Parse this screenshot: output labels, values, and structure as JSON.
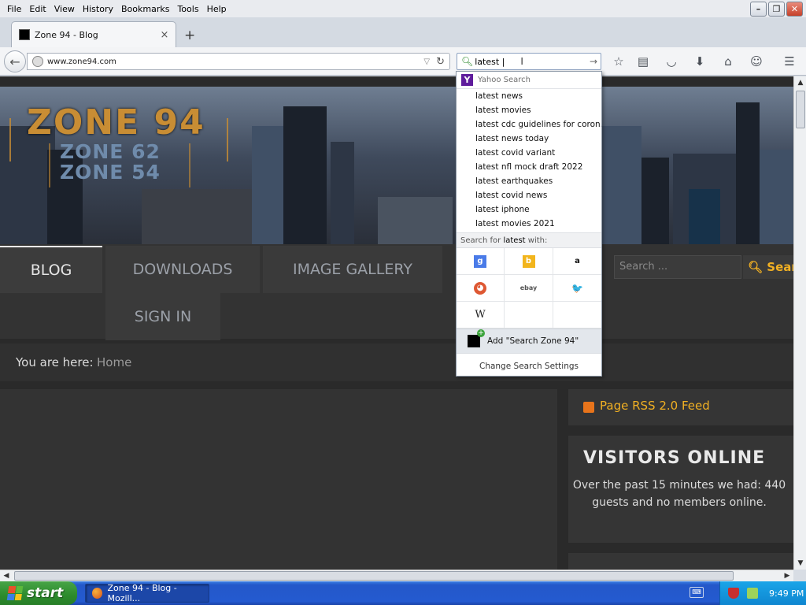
{
  "menu": {
    "items": [
      "File",
      "Edit",
      "View",
      "History",
      "Bookmarks",
      "Tools",
      "Help"
    ]
  },
  "window_controls": {
    "minimize": "–",
    "restore": "❐",
    "close": "✕"
  },
  "tab": {
    "title": "Zone 94 - Blog",
    "close": "×"
  },
  "new_tab": "+",
  "urlbar": {
    "url": "www.zone94.com"
  },
  "searchbox": {
    "value": "latest |"
  },
  "suggestions": {
    "engine_name": "Yahoo Search",
    "items": [
      "latest news",
      "latest movies",
      "latest cdc guidelines for coron...",
      "latest news today",
      "latest covid variant",
      "latest nfl mock draft 2022",
      "latest earthquakes",
      "latest covid news",
      "latest iphone",
      "latest movies 2021"
    ],
    "search_for_prefix": "Search for",
    "search_for_term": "latest",
    "search_for_suffix": "with:",
    "engines": [
      "google",
      "bing",
      "amazon",
      "duckduckgo",
      "ebay",
      "twitter",
      "wikipedia"
    ],
    "engine_glyphs": {
      "google": "g",
      "bing": "b",
      "amazon": "a",
      "duckduckgo": "◕",
      "ebay": "ebay",
      "twitter": "🐦",
      "wikipedia": "W"
    },
    "add_search": "Add \"Search Zone 94\"",
    "change_settings": "Change Search Settings"
  },
  "site": {
    "logo_main": "ZONE 94",
    "logo_sub1": "ZONE 62",
    "logo_sub2": "ZONE 54",
    "nav": [
      "BLOG",
      "DOWNLOADS",
      "IMAGE GALLERY",
      "SIGN IN"
    ],
    "search_placeholder": "Search ...",
    "search_button": "Search",
    "breadcrumb_label": "You are here:",
    "breadcrumb_home": "Home",
    "rss": "Page RSS 2.0 Feed",
    "visitors_title": "VISITORS ONLINE",
    "visitors_body": "Over the past 15 minutes we had: 440 guests and no members online."
  },
  "taskbar": {
    "start": "start",
    "item": "Zone 94 - Blog - Mozill...",
    "clock": "9:49 PM"
  },
  "colors": {
    "accent_orange": "#f1b023",
    "logo_gold": "#c88d34",
    "taskbar_blue": "#245ad0",
    "start_green": "#2c8b2c"
  }
}
